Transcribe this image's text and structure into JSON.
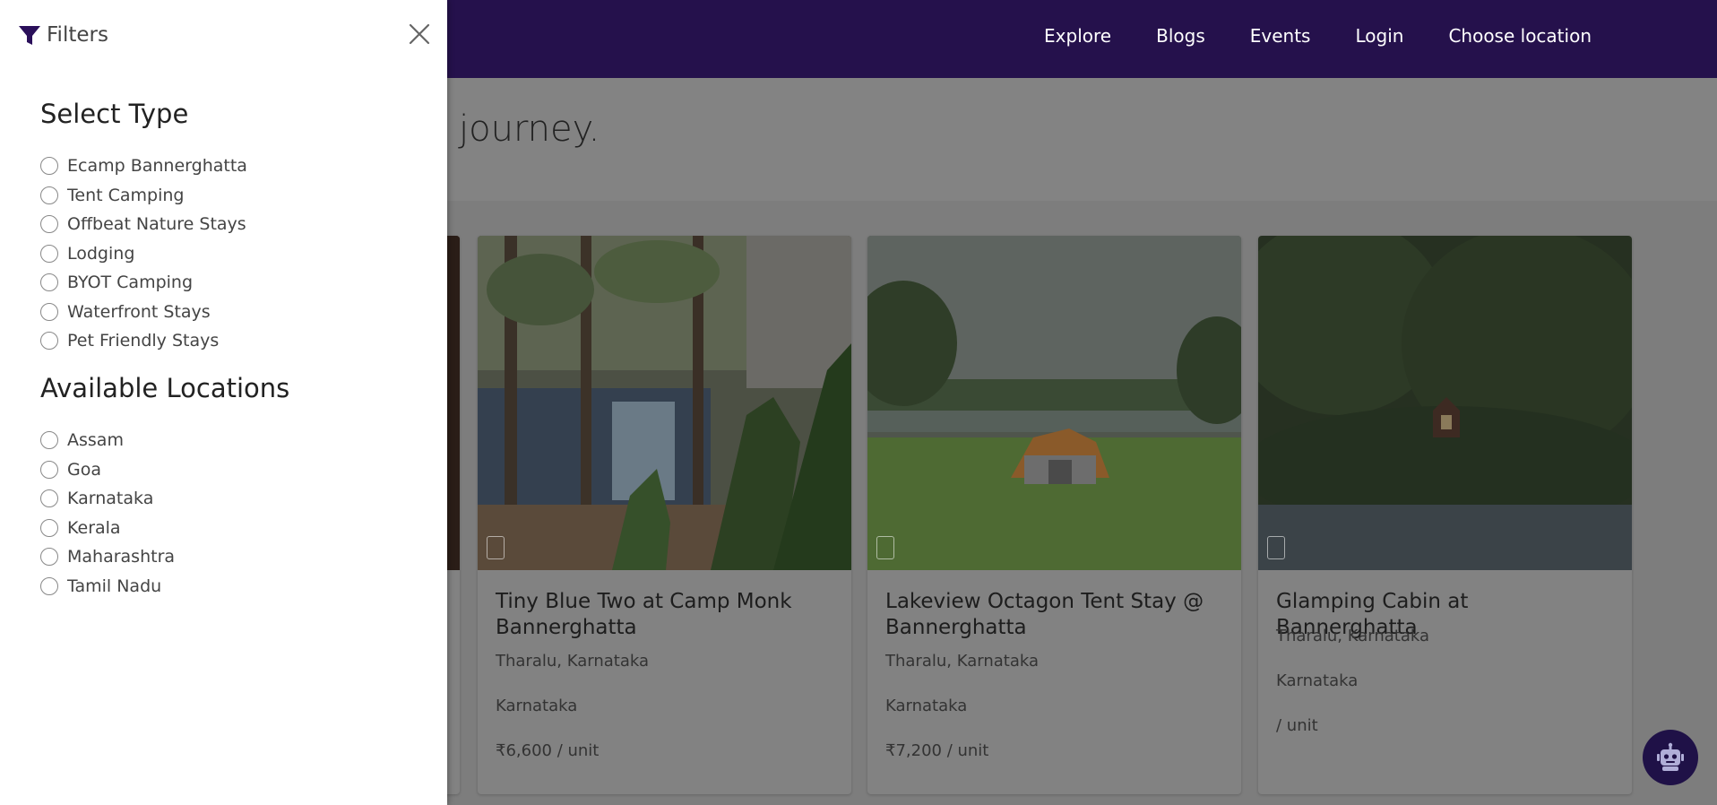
{
  "nav": {
    "links": [
      "Explore",
      "Blogs",
      "Events",
      "Login",
      "Choose location"
    ]
  },
  "hero": {
    "text": "journey."
  },
  "listings": [
    {
      "title": "Tiny Blue Two at Camp Monk Bannerghatta",
      "location": "Tharalu, Karnataka",
      "state": "Karnataka",
      "price": "₹6,600 / unit"
    },
    {
      "title": "Lakeview Octagon Tent Stay @ Bannerghatta",
      "location": "Tharalu, Karnataka",
      "state": "Karnataka",
      "price": "₹7,200 / unit"
    },
    {
      "title": "Glamping Cabin at Bannerghatta",
      "location": "Tharalu, Karnataka",
      "state": "Karnataka",
      "price": "/ unit"
    }
  ],
  "filters": {
    "title": "Filters",
    "type_heading": "Select Type",
    "types": [
      "Ecamp Bannerghatta",
      "Tent Camping",
      "Offbeat Nature Stays",
      "Lodging",
      "BYOT Camping",
      "Waterfront Stays",
      "Pet Friendly Stays"
    ],
    "location_heading": "Available Locations",
    "locations": [
      "Assam",
      "Goa",
      "Karnataka",
      "Kerala",
      "Maharashtra",
      "Tamil Nadu"
    ]
  },
  "icons": {
    "filter": "funnel-icon",
    "close": "close-icon",
    "chat": "robot-icon"
  },
  "colors": {
    "navbar": "#25114c",
    "accent": "#2a0f5a",
    "drawer_bg": "#ffffff"
  }
}
